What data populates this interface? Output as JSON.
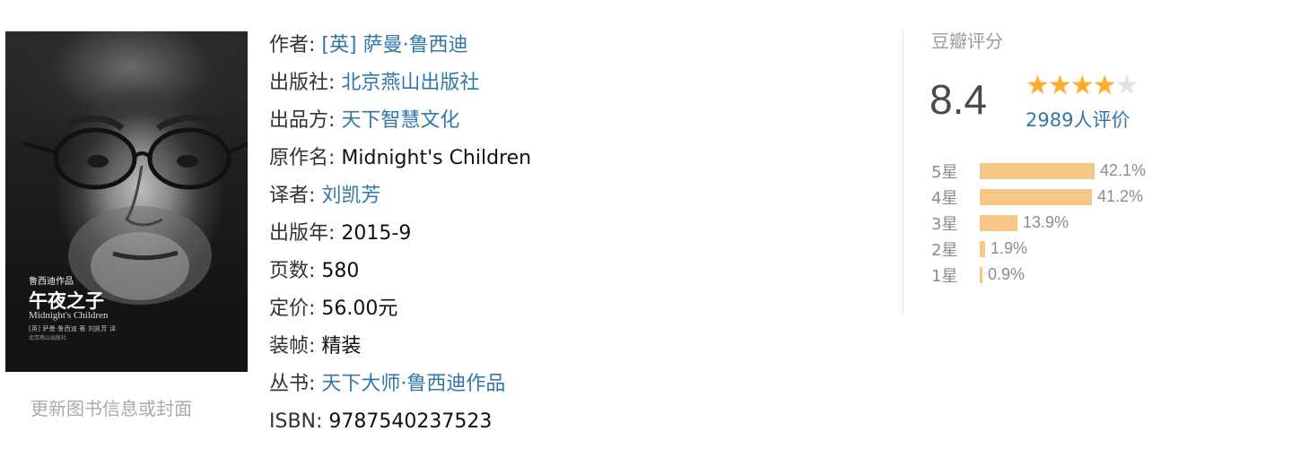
{
  "cover": {
    "series": "鲁西迪作品",
    "title": "午夜之子",
    "english_title": "Midnight's Children",
    "credit": "[英] 萨曼·鲁西迪 著   刘凯芳 译",
    "publisher_small": "北京燕山出版社"
  },
  "update_link": "更新图书信息或封面",
  "info": [
    {
      "label": "作者:",
      "value": "[英] 萨曼·鲁西迪",
      "link": true
    },
    {
      "label": "出版社:",
      "value": "北京燕山出版社",
      "link": true
    },
    {
      "label": "出品方:",
      "value": "天下智慧文化",
      "link": true
    },
    {
      "label": "原作名:",
      "value": "Midnight's Children",
      "link": false
    },
    {
      "label": "译者:",
      "value": "刘凯芳",
      "link": true
    },
    {
      "label": "出版年:",
      "value": "2015-9",
      "link": false
    },
    {
      "label": "页数:",
      "value": "580",
      "link": false
    },
    {
      "label": "定价:",
      "value": "56.00元",
      "link": false
    },
    {
      "label": "装帧:",
      "value": "精装",
      "link": false
    },
    {
      "label": "丛书:",
      "value": "天下大师·鲁西迪作品",
      "link": true
    },
    {
      "label": "ISBN:",
      "value": "9787540237523",
      "link": false
    }
  ],
  "rating": {
    "title": "豆瓣评分",
    "score": "8.4",
    "stars_filled": 4,
    "stars_total": 5,
    "count_text": "2989人评价",
    "distribution": [
      {
        "label": "5星",
        "percent": 42.1,
        "percent_text": "42.1%"
      },
      {
        "label": "4星",
        "percent": 41.2,
        "percent_text": "41.2%"
      },
      {
        "label": "3星",
        "percent": 13.9,
        "percent_text": "13.9%"
      },
      {
        "label": "2星",
        "percent": 1.9,
        "percent_text": "1.9%"
      },
      {
        "label": "1星",
        "percent": 0.9,
        "percent_text": "0.9%"
      }
    ],
    "colors": {
      "star": "#ffac2d",
      "star_empty": "#e3e3e3",
      "bar": "#f7c788",
      "link": "#3377aa"
    }
  }
}
